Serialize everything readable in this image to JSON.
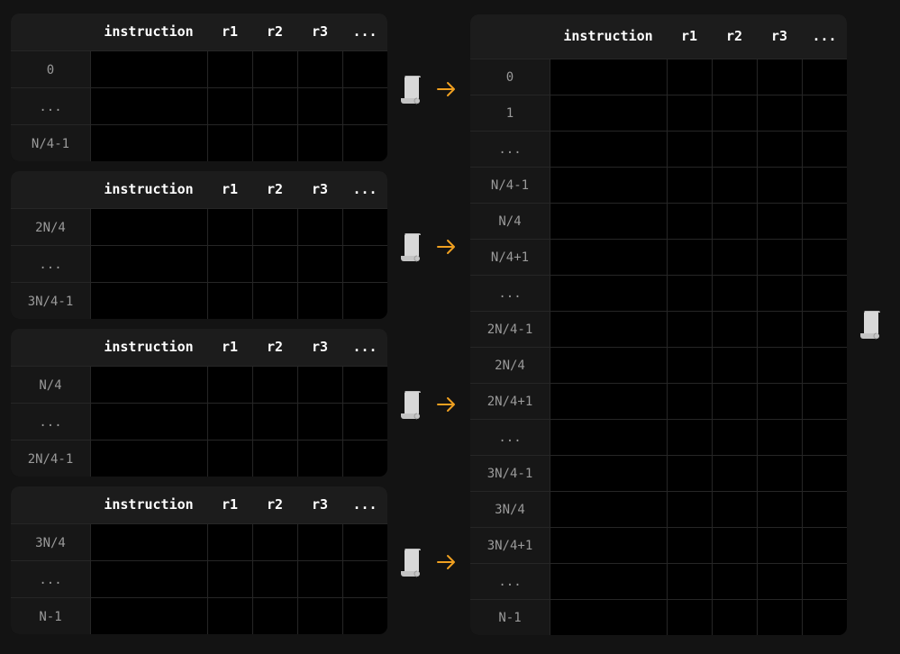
{
  "headers": [
    "instruction",
    "r1",
    "r2",
    "r3",
    "..."
  ],
  "left_tables": [
    {
      "rows": [
        "0",
        "...",
        "N/4-1"
      ]
    },
    {
      "rows": [
        "2N/4",
        "...",
        "3N/4-1"
      ]
    },
    {
      "rows": [
        "N/4",
        "...",
        "2N/4-1"
      ]
    },
    {
      "rows": [
        "3N/4",
        "...",
        "N-1"
      ]
    }
  ],
  "right_table": {
    "rows": [
      "0",
      "1",
      "...",
      "N/4-1",
      "N/4",
      "N/4+1",
      "...",
      "2N/4-1",
      "2N/4",
      "2N/4+1",
      "...",
      "3N/4-1",
      "3N/4",
      "3N/4+1",
      "...",
      "N-1"
    ]
  },
  "icons": {
    "connector": "scroll-icon",
    "arrow": "arrow-right-icon"
  },
  "colors": {
    "arrow": "#f0a020",
    "scroll": "#d8d8d8"
  }
}
